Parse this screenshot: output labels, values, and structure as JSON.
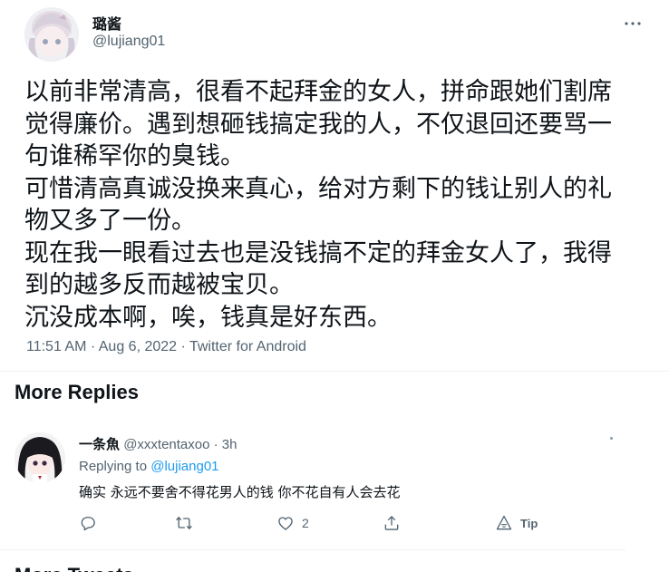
{
  "tweet": {
    "author_name": "璐酱",
    "author_handle": "@lujiang01",
    "body": "以前非常清高，很看不起拜金的女人，拼命跟她们割席\n觉得廉价。遇到想砸钱搞定我的人，不仅退回还要骂一\n句谁稀罕你的臭钱。\n可惜清高真诚没换来真心，给对方剩下的钱让别人的礼\n物又多了一份。\n现在我一眼看过去也是没钱搞不定的拜金女人了，我得\n到的越多反而越被宝贝。\n沉没成本啊，唉，钱真是好东西。",
    "meta": "11:51 AM · Aug 6, 2022 · Twitter for Android"
  },
  "more_replies_title": "More Replies",
  "reply": {
    "name": "一条魚",
    "handle": "@xxxtentaxoo · 3h",
    "replying_prefix": "Replying to ",
    "replying_to": "@lujiang01",
    "text": "确实 永远不要舍不得花男人的钱 你不花自有人会去花",
    "like_count": "2",
    "tip_label": "Tip"
  },
  "bottom_partial_title": "More Tweets",
  "colors": {
    "text": "#0f1419",
    "secondary": "#536471",
    "link": "#1d9bf0",
    "divider": "#eff3f4"
  },
  "icons": [
    "more-icon",
    "reply-icon",
    "retweet-icon",
    "like-icon",
    "share-icon",
    "tip-icon"
  ]
}
